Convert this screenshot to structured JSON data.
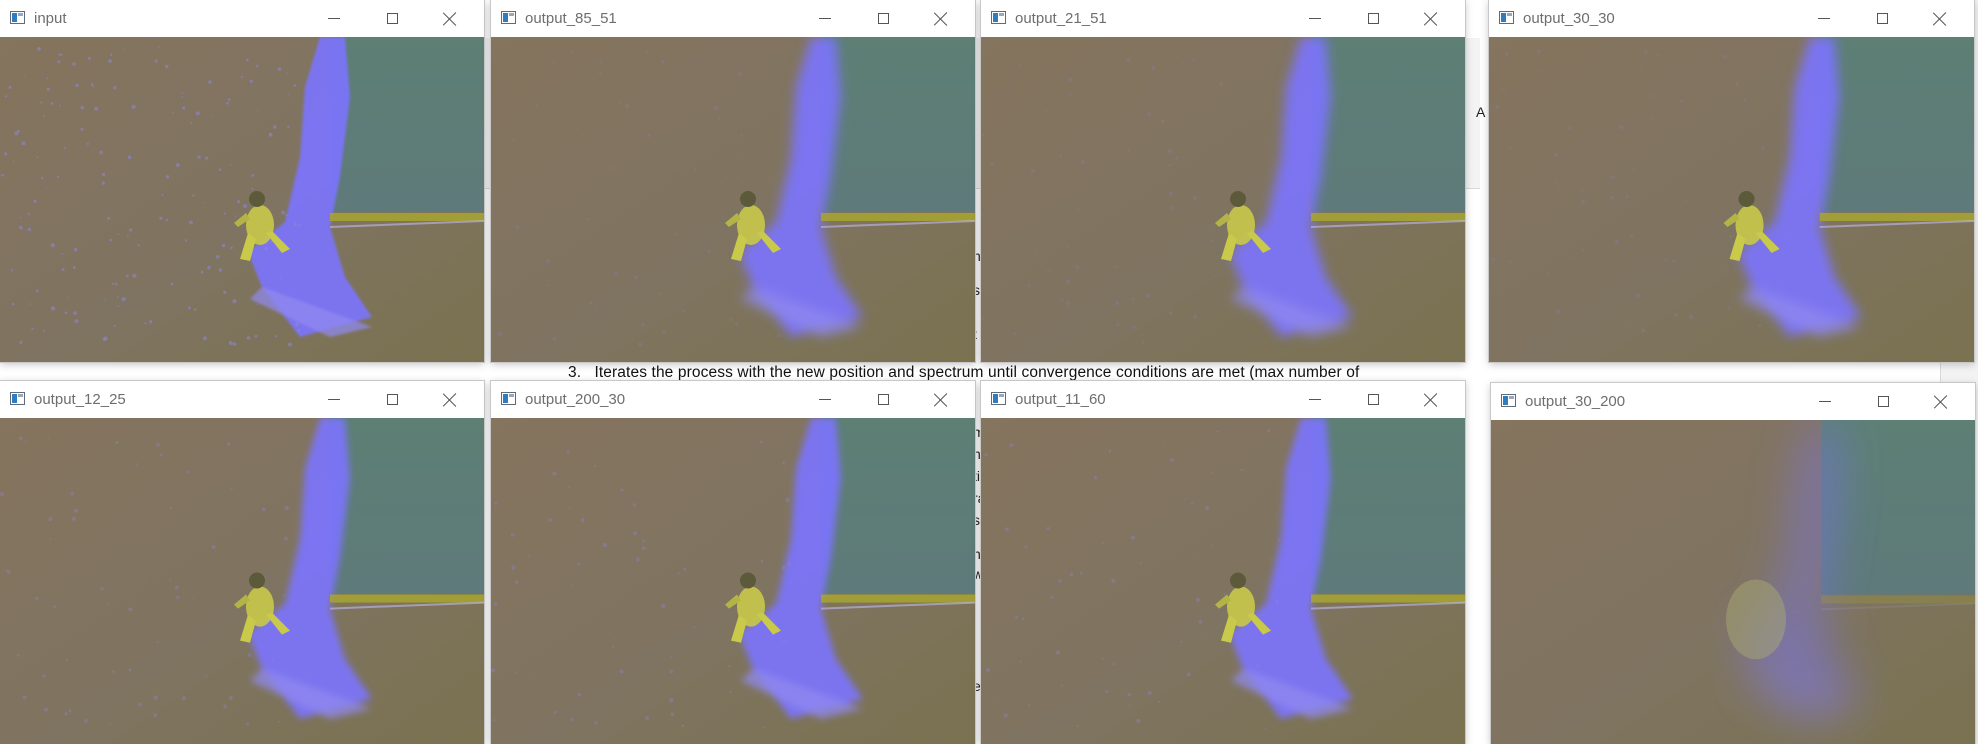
{
  "document_background": {
    "visible_line": {
      "number": "3.",
      "text": "Iterates the process with the new position and spectrum until convergence conditions are met (max number of"
    },
    "fragments": [
      "A",
      "n",
      "s",
      "t",
      "n",
      "ti",
      "ra",
      "st",
      "nt",
      "w",
      "e",
      "m",
      "s",
      "a",
      "h"
    ]
  },
  "windows": [
    {
      "title": "input"
    },
    {
      "title": "output_85_51"
    },
    {
      "title": "output_21_51"
    },
    {
      "title": "output_30_30"
    },
    {
      "title": "output_12_25"
    },
    {
      "title": "output_200_30"
    },
    {
      "title": "output_11_60"
    },
    {
      "title": "output_30_200"
    }
  ],
  "colors": {
    "sky": "#5e7a7a",
    "sand": "#85745e",
    "wave": "#7b73ff",
    "surfer": "#c9c94a",
    "horizon": "#a7a630"
  }
}
